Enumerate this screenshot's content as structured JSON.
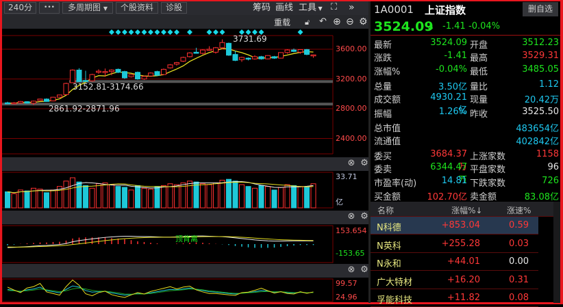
{
  "toolbar": {
    "period": "240分",
    "more": "•••",
    "multi_period": "多周期图",
    "stock_info": "个股资料",
    "diagnose": "诊股",
    "chips": "筹码",
    "draw": "画线",
    "tools": "工具",
    "reload": "重载"
  },
  "stock": {
    "code": "1A0001",
    "name": "上证指数",
    "remove_watch": "删自选",
    "price": "3524.09",
    "change": "-1.41",
    "change_pct": "-0.04%",
    "arrow": "↓"
  },
  "quote": [
    {
      "l1": "最新",
      "v1": "3524.09",
      "c1": "g",
      "l2": "开盘",
      "v2": "3512.23",
      "c2": "g"
    },
    {
      "l1": "涨跌",
      "v1": "-1.41",
      "c1": "g",
      "l2": "最高",
      "v2": "3529.31",
      "c2": "r"
    },
    {
      "l1": "涨幅%",
      "v1": "-0.04%",
      "c1": "g",
      "l2": "最低",
      "v2": "3485.05",
      "c2": "g"
    },
    {
      "l1": "总量",
      "v1": "3.50亿",
      "c1": "c",
      "l2": "量比",
      "v2": "1.12",
      "c2": "c"
    },
    {
      "l1": "成交额",
      "v1": "4930.21亿",
      "c1": "c",
      "l2": "现量",
      "v2": "20.42万",
      "c2": "c"
    },
    {
      "l1": "振幅",
      "v1": "1.26%",
      "c1": "c",
      "l2": "昨收",
      "v2": "3525.50",
      "c2": "w"
    },
    {
      "l1": "总市值",
      "v1": "",
      "c1": "c",
      "l2": "",
      "v2": "483654亿",
      "c2": "c"
    },
    {
      "l1": "流通值",
      "v1": "",
      "c1": "c",
      "l2": "",
      "v2": "402842亿",
      "c2": "c"
    },
    {
      "l1": "委买",
      "v1": "3684.37万",
      "c1": "r",
      "l2": "上涨家数",
      "v2": "1158",
      "c2": "r"
    },
    {
      "l1": "委卖",
      "v1": "6344.47万",
      "c1": "g",
      "l2": "平盘家数",
      "v2": "96",
      "c2": "w"
    },
    {
      "l1": "市盈率(动)",
      "v1": "14.81",
      "c1": "c",
      "l2": "下跌家数",
      "v2": "726",
      "c2": "g"
    },
    {
      "l1": "买金额",
      "v1": "102.70亿",
      "c1": "r",
      "l2": "卖金额",
      "v2": "83.08亿",
      "c2": "g"
    }
  ],
  "ranking": {
    "headers": [
      "名称",
      "涨幅%↓",
      "涨速%"
    ],
    "rows": [
      {
        "name": "N科德",
        "pct": "+853.04",
        "speed": "0.59",
        "sc": "r"
      },
      {
        "name": "N英科",
        "pct": "+255.28",
        "speed": "0.03",
        "sc": "r"
      },
      {
        "name": "N永和",
        "pct": "+44.01",
        "speed": "0.00",
        "sc": "w"
      },
      {
        "name": "广大特材",
        "pct": "+16.20",
        "speed": "0.31",
        "sc": "r"
      },
      {
        "name": "孚能科技",
        "pct": "+11.82",
        "speed": "0.08",
        "sc": "r"
      }
    ]
  },
  "chart_data": {
    "type": "candlestick",
    "y_ticks": [
      "3600.00",
      "3200.00",
      "2800.00",
      "2400.00"
    ],
    "y_tick_values": [
      3600,
      3200,
      2800,
      2400
    ],
    "ylim": [
      2250,
      3880
    ],
    "high_label": "3731.69",
    "support_bands": [
      {
        "label": "3152.81-3174.66",
        "low": 3152.81,
        "high": 3174.66
      },
      {
        "label": "2861.92-2871.96",
        "low": 2861.92,
        "high": 2871.96
      }
    ],
    "signal_indices": [
      16,
      17,
      18,
      19,
      20,
      21,
      22,
      23,
      24,
      25,
      26,
      28,
      31,
      32,
      33,
      36,
      37,
      38,
      39,
      45
    ],
    "ohlc": [
      [
        2880,
        2895,
        2868,
        2872
      ],
      [
        2872,
        2890,
        2860,
        2880
      ],
      [
        2878,
        2905,
        2870,
        2898
      ],
      [
        2895,
        2900,
        2870,
        2875
      ],
      [
        2875,
        2910,
        2850,
        2902
      ],
      [
        2910,
        2935,
        2905,
        2930
      ],
      [
        2930,
        2940,
        2895,
        2898
      ],
      [
        2905,
        2960,
        2900,
        2955
      ],
      [
        2955,
        2990,
        2950,
        2985
      ],
      [
        2990,
        3150,
        2985,
        3140
      ],
      [
        3150,
        3330,
        3145,
        3320
      ],
      [
        3320,
        3345,
        3160,
        3165
      ],
      [
        3180,
        3310,
        3165,
        3175
      ],
      [
        3175,
        3270,
        3165,
        3260
      ],
      [
        3290,
        3330,
        3270,
        3305
      ],
      [
        3290,
        3340,
        3230,
        3300
      ],
      [
        3300,
        3330,
        3250,
        3320
      ],
      [
        3330,
        3340,
        3280,
        3290
      ],
      [
        3300,
        3310,
        3200,
        3215
      ],
      [
        3230,
        3265,
        3220,
        3258
      ],
      [
        3290,
        3300,
        3190,
        3200
      ],
      [
        3200,
        3245,
        3190,
        3235
      ],
      [
        3240,
        3290,
        3230,
        3280
      ],
      [
        3300,
        3310,
        3240,
        3250
      ],
      [
        3260,
        3340,
        3255,
        3330
      ],
      [
        3350,
        3400,
        3340,
        3390
      ],
      [
        3400,
        3430,
        3380,
        3420
      ],
      [
        3440,
        3500,
        3430,
        3490
      ],
      [
        3500,
        3560,
        3490,
        3550
      ],
      [
        3560,
        3620,
        3540,
        3545
      ],
      [
        3545,
        3600,
        3530,
        3590
      ],
      [
        3600,
        3640,
        3580,
        3600
      ],
      [
        3560,
        3630,
        3540,
        3620
      ],
      [
        3620,
        3731.69,
        3600,
        3690
      ],
      [
        3680,
        3690,
        3510,
        3520
      ],
      [
        3530,
        3580,
        3440,
        3450
      ],
      [
        3460,
        3500,
        3430,
        3490
      ],
      [
        3480,
        3490,
        3450,
        3470
      ],
      [
        3470,
        3520,
        3460,
        3500
      ],
      [
        3500,
        3510,
        3460,
        3470
      ],
      [
        3470,
        3520,
        3465,
        3515
      ],
      [
        3500,
        3510,
        3470,
        3480
      ],
      [
        3480,
        3560,
        3475,
        3555
      ],
      [
        3555,
        3600,
        3540,
        3590
      ],
      [
        3590,
        3610,
        3560,
        3570
      ],
      [
        3560,
        3600,
        3540,
        3595
      ],
      [
        3595,
        3605,
        3520,
        3530
      ],
      [
        3512.23,
        3529.31,
        3485.05,
        3524.09
      ]
    ],
    "volume": {
      "max_label": "33.71",
      "unit": "亿",
      "max": 33.71,
      "values": [
        18,
        16,
        20,
        19,
        22,
        21,
        17,
        20,
        24,
        30,
        33.7,
        29,
        25,
        22,
        27,
        28,
        26,
        24,
        23,
        20,
        25,
        22,
        21,
        24,
        25,
        27,
        26,
        28,
        30,
        29,
        27,
        26,
        28,
        31,
        32,
        30,
        26,
        24,
        22,
        25,
        24,
        20,
        23,
        26,
        25,
        24,
        23,
        27
      ]
    },
    "macd": {
      "max_label": "153.654",
      "min_label": "-153.65",
      "annotation": "顶背离",
      "range": 153.654,
      "dif": [
        -30,
        -28,
        -25,
        -22,
        -18,
        -14,
        -12,
        -8,
        -4,
        5,
        20,
        30,
        38,
        45,
        52,
        58,
        62,
        66,
        68,
        68,
        66,
        65,
        64,
        62,
        60,
        60,
        62,
        64,
        68,
        70,
        70,
        68,
        66,
        64,
        60,
        54,
        48,
        42,
        36,
        32,
        28,
        26,
        26,
        27,
        28,
        29,
        28,
        27
      ],
      "dea": [
        -25,
        -26,
        -26,
        -25,
        -23,
        -21,
        -19,
        -17,
        -14,
        -10,
        -4,
        2,
        9,
        16,
        23,
        30,
        36,
        42,
        47,
        51,
        54,
        56,
        58,
        59,
        60,
        60,
        60,
        61,
        62,
        63,
        64,
        65,
        65,
        65,
        64,
        62,
        59,
        56,
        52,
        48,
        44,
        41,
        38,
        36,
        34,
        33,
        32,
        31
      ]
    },
    "osc": {
      "max_label": "99.57",
      "min_label": "24.96",
      "min": 10,
      "max": 99.57,
      "k": [
        60,
        55,
        50,
        58,
        62,
        70,
        55,
        50,
        45,
        60,
        75,
        70,
        55,
        48,
        50,
        52,
        45,
        40,
        35,
        38,
        42,
        40,
        45,
        50,
        55,
        60,
        58,
        62,
        66,
        60,
        55,
        50,
        48,
        45,
        42,
        40,
        44,
        46,
        50,
        55,
        52,
        48,
        50,
        46,
        44,
        48,
        45,
        47
      ],
      "d": [
        55,
        54,
        52,
        54,
        57,
        62,
        58,
        54,
        50,
        54,
        62,
        66,
        62,
        56,
        52,
        52,
        49,
        45,
        40,
        39,
        40,
        40,
        42,
        46,
        50,
        54,
        56,
        58,
        62,
        61,
        58,
        54,
        51,
        48,
        45,
        43,
        43,
        45,
        47,
        50,
        51,
        50,
        50,
        48,
        46,
        47,
        46,
        46
      ],
      "j": [
        70,
        57,
        46,
        66,
        72,
        86,
        49,
        42,
        35,
        72,
        101,
        78,
        41,
        32,
        46,
        52,
        37,
        30,
        25,
        36,
        46,
        40,
        51,
        58,
        65,
        72,
        62,
        70,
        74,
        58,
        49,
        42,
        42,
        39,
        36,
        34,
        46,
        48,
        56,
        65,
        54,
        44,
        50,
        42,
        40,
        50,
        43,
        49
      ]
    }
  }
}
